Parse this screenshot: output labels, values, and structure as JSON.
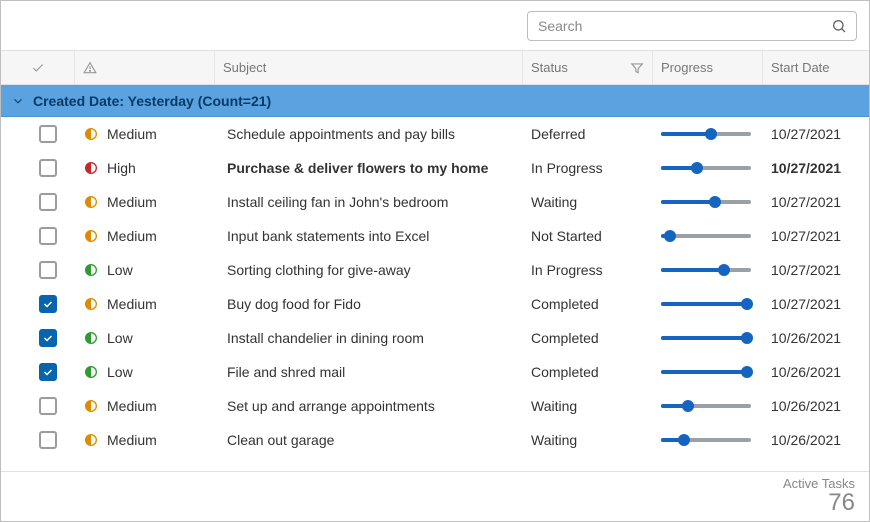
{
  "search": {
    "placeholder": "Search"
  },
  "columns": {
    "subject": "Subject",
    "status": "Status",
    "progress": "Progress",
    "start_date": "Start Date"
  },
  "group": {
    "label": "Created Date: Yesterday (Count=21)"
  },
  "priority_colors": {
    "Low": {
      "stroke": "#2e9b2e",
      "fill": "#2e9b2e"
    },
    "Medium": {
      "stroke": "#e08a00",
      "fill": "#e08a00"
    },
    "High": {
      "stroke": "#c62828",
      "fill": "#c62828"
    }
  },
  "rows": [
    {
      "checked": false,
      "priority": "Medium",
      "subject": "Schedule appointments and pay bills",
      "status": "Deferred",
      "progress": 55,
      "date": "10/27/2021",
      "bold": false
    },
    {
      "checked": false,
      "priority": "High",
      "subject": "Purchase & deliver flowers to my home",
      "status": "In Progress",
      "progress": 40,
      "date": "10/27/2021",
      "bold": true
    },
    {
      "checked": false,
      "priority": "Medium",
      "subject": "Install ceiling fan in John's bedroom",
      "status": "Waiting",
      "progress": 60,
      "date": "10/27/2021",
      "bold": false
    },
    {
      "checked": false,
      "priority": "Medium",
      "subject": "Input bank statements into Excel",
      "status": "Not Started",
      "progress": 10,
      "date": "10/27/2021",
      "bold": false
    },
    {
      "checked": false,
      "priority": "Low",
      "subject": "Sorting clothing for give-away",
      "status": "In Progress",
      "progress": 70,
      "date": "10/27/2021",
      "bold": false
    },
    {
      "checked": true,
      "priority": "Medium",
      "subject": "Buy dog food for Fido",
      "status": "Completed",
      "progress": 95,
      "date": "10/27/2021",
      "bold": false
    },
    {
      "checked": true,
      "priority": "Low",
      "subject": "Install chandelier in dining room",
      "status": "Completed",
      "progress": 95,
      "date": "10/26/2021",
      "bold": false
    },
    {
      "checked": true,
      "priority": "Low",
      "subject": "File and shred mail",
      "status": "Completed",
      "progress": 95,
      "date": "10/26/2021",
      "bold": false
    },
    {
      "checked": false,
      "priority": "Medium",
      "subject": "Set up and arrange appointments",
      "status": "Waiting",
      "progress": 30,
      "date": "10/26/2021",
      "bold": false
    },
    {
      "checked": false,
      "priority": "Medium",
      "subject": "Clean out garage",
      "status": "Waiting",
      "progress": 25,
      "date": "10/26/2021",
      "bold": false
    }
  ],
  "footer": {
    "label": "Active Tasks",
    "value": "76"
  }
}
